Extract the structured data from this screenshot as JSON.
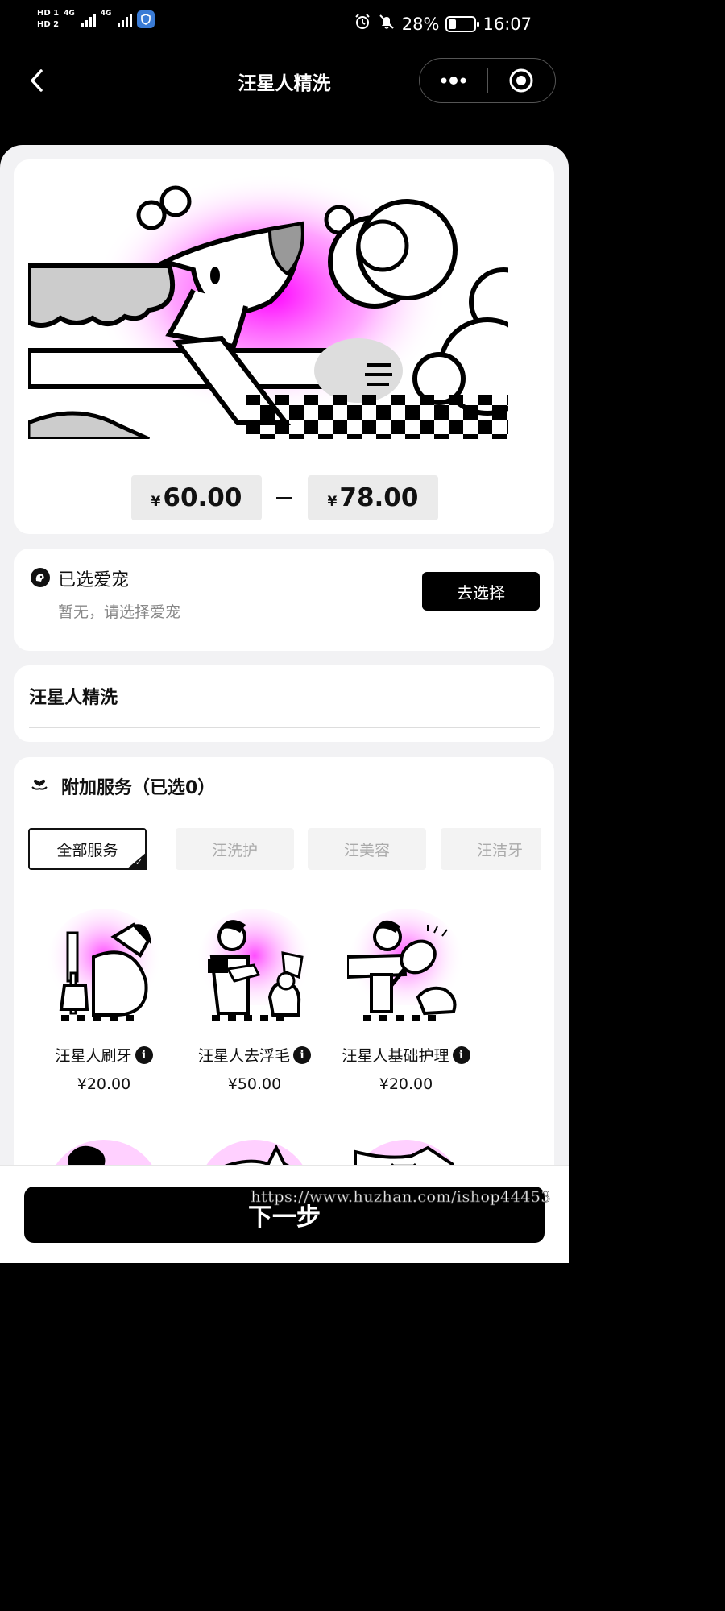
{
  "status_bar": {
    "hd1": "HD 1",
    "hd2": "HD 2",
    "net1": "4G",
    "net2": "4G",
    "battery": "28%",
    "battery_level": 0.28,
    "time": "16:07",
    "icons": [
      "alarm-icon",
      "mute-icon",
      "battery-icon",
      "shield-app-icon"
    ]
  },
  "nav": {
    "title": "汪星人精洗",
    "back_icon": "chevron-left-icon",
    "more_icon": "more-dots-icon",
    "close_icon": "target-close-icon"
  },
  "hero": {
    "currency": "¥",
    "price_min": "60.00",
    "price_max": "78.00"
  },
  "pet": {
    "title": "已选爱宠",
    "subtitle": "暂无，请选择爱宠",
    "choose_label": "去选择",
    "icon": "pet-badge-icon"
  },
  "service": {
    "name": "汪星人精洗"
  },
  "addon": {
    "title": "附加服务（已选0）",
    "icon": "heart-hand-icon",
    "tabs": [
      {
        "label": "全部服务",
        "active": true
      },
      {
        "label": "汪洗护",
        "active": false
      },
      {
        "label": "汪美容",
        "active": false
      },
      {
        "label": "汪洁牙",
        "active": false
      }
    ],
    "items": [
      {
        "name": "汪星人刷牙",
        "price": "¥20.00",
        "info_icon": "info-icon"
      },
      {
        "name": "汪星人去浮毛",
        "price": "¥50.00",
        "info_icon": "info-icon"
      },
      {
        "name": "汪星人基础护理",
        "price": "¥20.00",
        "info_icon": "info-icon"
      }
    ]
  },
  "bottom": {
    "next_label": "下一步",
    "watermark": "https://www.huzhan.com/ishop44453"
  },
  "colors": {
    "accent": "#ff00ff",
    "dark": "#000000",
    "page_bg": "#f2f2f4"
  }
}
